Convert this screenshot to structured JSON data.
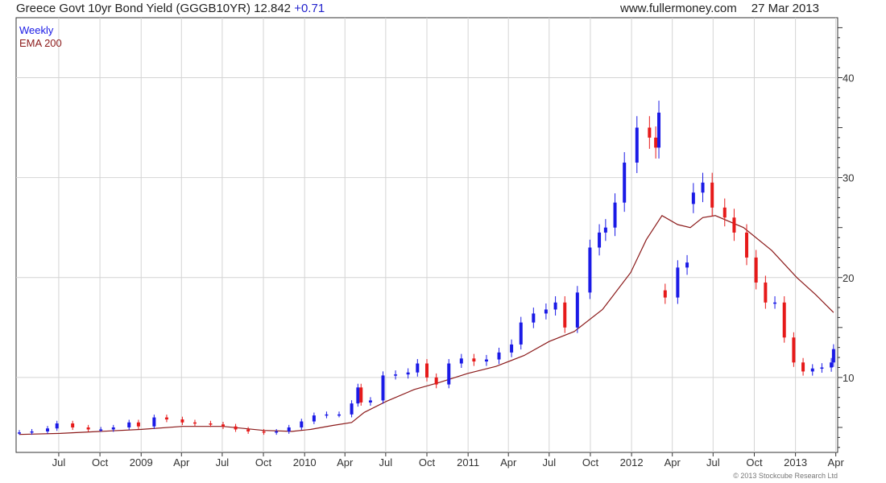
{
  "header": {
    "title": "Greece Govt 10yr Bond Yield (GGGB10YR)",
    "last": "12.842",
    "change": "+0.71",
    "site": "www.fullermoney.com",
    "date": "27 Mar 2013"
  },
  "copyright": "© 2013 Stockcube Research Ltd",
  "colors": {
    "up": "#1a1ae6",
    "down": "#e61a1a",
    "ema": "#8b1a1a",
    "grid": "#d4d4d4"
  },
  "chart_data": {
    "type": "line",
    "title": "Greece Govt 10yr Bond Yield (GGGB10YR)",
    "ylim": [
      2.5,
      46
    ],
    "yticks": [
      10,
      20,
      30,
      40
    ],
    "grid": true,
    "legend_placement": "top-left",
    "x_tick_labels": [
      "Jul",
      "Oct",
      "2009",
      "Apr",
      "Jul",
      "Oct",
      "2010",
      "Apr",
      "Jul",
      "Oct",
      "2011",
      "Apr",
      "Jul",
      "Oct",
      "2012",
      "Apr",
      "Jul",
      "Oct",
      "2013",
      "Apr"
    ],
    "x_tick_dates": [
      "2008-07-01",
      "2008-10-01",
      "2009-01-01",
      "2009-04-01",
      "2009-07-01",
      "2009-10-01",
      "2010-01-01",
      "2010-04-01",
      "2010-07-01",
      "2010-10-01",
      "2011-01-01",
      "2011-04-01",
      "2011-07-01",
      "2011-10-01",
      "2012-01-01",
      "2012-04-01",
      "2012-07-01",
      "2012-10-01",
      "2013-01-01",
      "2013-04-01"
    ],
    "series": [
      {
        "name": "Weekly",
        "style": "candlestick",
        "points": [
          [
            "2008-04-04",
            4.5
          ],
          [
            "2008-05-02",
            4.6
          ],
          [
            "2008-06-06",
            4.9
          ],
          [
            "2008-06-27",
            5.4
          ],
          [
            "2008-08-01",
            5.0
          ],
          [
            "2008-09-05",
            4.8
          ],
          [
            "2008-10-03",
            4.8
          ],
          [
            "2008-10-31",
            5.0
          ],
          [
            "2008-12-05",
            5.5
          ],
          [
            "2008-12-26",
            5.1
          ],
          [
            "2009-01-30",
            6.0
          ],
          [
            "2009-02-27",
            5.8
          ],
          [
            "2009-04-03",
            5.5
          ],
          [
            "2009-05-01",
            5.4
          ],
          [
            "2009-06-05",
            5.3
          ],
          [
            "2009-07-03",
            5.1
          ],
          [
            "2009-07-31",
            4.8
          ],
          [
            "2009-08-28",
            4.6
          ],
          [
            "2009-10-02",
            4.5
          ],
          [
            "2009-10-30",
            4.6
          ],
          [
            "2009-11-27",
            5.0
          ],
          [
            "2009-12-25",
            5.6
          ],
          [
            "2010-01-22",
            6.2
          ],
          [
            "2010-02-19",
            6.3
          ],
          [
            "2010-03-19",
            6.3
          ],
          [
            "2010-04-16",
            7.4
          ],
          [
            "2010-04-30",
            9.0
          ],
          [
            "2010-05-07",
            7.5
          ],
          [
            "2010-05-28",
            7.7
          ],
          [
            "2010-06-25",
            10.2
          ],
          [
            "2010-07-23",
            10.3
          ],
          [
            "2010-08-20",
            10.5
          ],
          [
            "2010-09-10",
            11.4
          ],
          [
            "2010-10-01",
            10.0
          ],
          [
            "2010-10-22",
            9.3
          ],
          [
            "2010-11-19",
            11.4
          ],
          [
            "2010-12-17",
            11.9
          ],
          [
            "2011-01-14",
            11.6
          ],
          [
            "2011-02-11",
            11.8
          ],
          [
            "2011-03-11",
            12.5
          ],
          [
            "2011-04-08",
            13.3
          ],
          [
            "2011-04-29",
            15.5
          ],
          [
            "2011-05-27",
            16.4
          ],
          [
            "2011-06-24",
            16.8
          ],
          [
            "2011-07-15",
            17.5
          ],
          [
            "2011-08-05",
            15.0
          ],
          [
            "2011-09-02",
            18.5
          ],
          [
            "2011-09-30",
            23.0
          ],
          [
            "2011-10-21",
            24.5
          ],
          [
            "2011-11-04",
            25.0
          ],
          [
            "2011-11-25",
            27.5
          ],
          [
            "2011-12-16",
            31.5
          ],
          [
            "2012-01-13",
            35.0
          ],
          [
            "2012-02-10",
            34.0
          ],
          [
            "2012-02-24",
            33.0
          ],
          [
            "2012-03-02",
            36.5
          ],
          [
            "2012-03-16",
            18.0
          ],
          [
            "2012-04-13",
            21.0
          ],
          [
            "2012-05-04",
            21.5
          ],
          [
            "2012-05-18",
            28.5
          ],
          [
            "2012-06-08",
            29.5
          ],
          [
            "2012-06-29",
            27.0
          ],
          [
            "2012-07-27",
            26.0
          ],
          [
            "2012-08-17",
            24.5
          ],
          [
            "2012-09-14",
            22.0
          ],
          [
            "2012-10-05",
            19.5
          ],
          [
            "2012-10-26",
            17.5
          ],
          [
            "2012-11-16",
            17.5
          ],
          [
            "2012-12-07",
            14.0
          ],
          [
            "2012-12-28",
            11.5
          ],
          [
            "2013-01-18",
            10.6
          ],
          [
            "2013-02-08",
            10.9
          ],
          [
            "2013-03-01",
            11.0
          ],
          [
            "2013-03-22",
            11.5
          ],
          [
            "2013-03-27",
            12.84
          ]
        ]
      },
      {
        "name": "EMA 200",
        "style": "line",
        "points": [
          [
            "2008-04-04",
            4.3
          ],
          [
            "2008-07-04",
            4.4
          ],
          [
            "2008-10-03",
            4.6
          ],
          [
            "2009-01-02",
            4.8
          ],
          [
            "2009-04-03",
            5.1
          ],
          [
            "2009-07-03",
            5.1
          ],
          [
            "2009-10-02",
            4.7
          ],
          [
            "2009-12-04",
            4.6
          ],
          [
            "2010-01-15",
            4.8
          ],
          [
            "2010-03-05",
            5.2
          ],
          [
            "2010-04-16",
            5.5
          ],
          [
            "2010-05-14",
            6.5
          ],
          [
            "2010-07-02",
            7.6
          ],
          [
            "2010-09-03",
            8.8
          ],
          [
            "2010-10-29",
            9.5
          ],
          [
            "2010-12-31",
            10.4
          ],
          [
            "2011-03-04",
            11.1
          ],
          [
            "2011-05-06",
            12.2
          ],
          [
            "2011-07-01",
            13.6
          ],
          [
            "2011-08-26",
            14.6
          ],
          [
            "2011-10-28",
            16.8
          ],
          [
            "2011-12-30",
            20.5
          ],
          [
            "2012-02-03",
            23.8
          ],
          [
            "2012-03-09",
            26.2
          ],
          [
            "2012-04-13",
            25.3
          ],
          [
            "2012-05-11",
            25.0
          ],
          [
            "2012-06-08",
            26.0
          ],
          [
            "2012-07-06",
            26.2
          ],
          [
            "2012-09-07",
            25.0
          ],
          [
            "2012-11-09",
            22.7
          ],
          [
            "2013-01-04",
            20.0
          ],
          [
            "2013-02-15",
            18.3
          ],
          [
            "2013-03-27",
            16.5
          ]
        ]
      }
    ]
  }
}
